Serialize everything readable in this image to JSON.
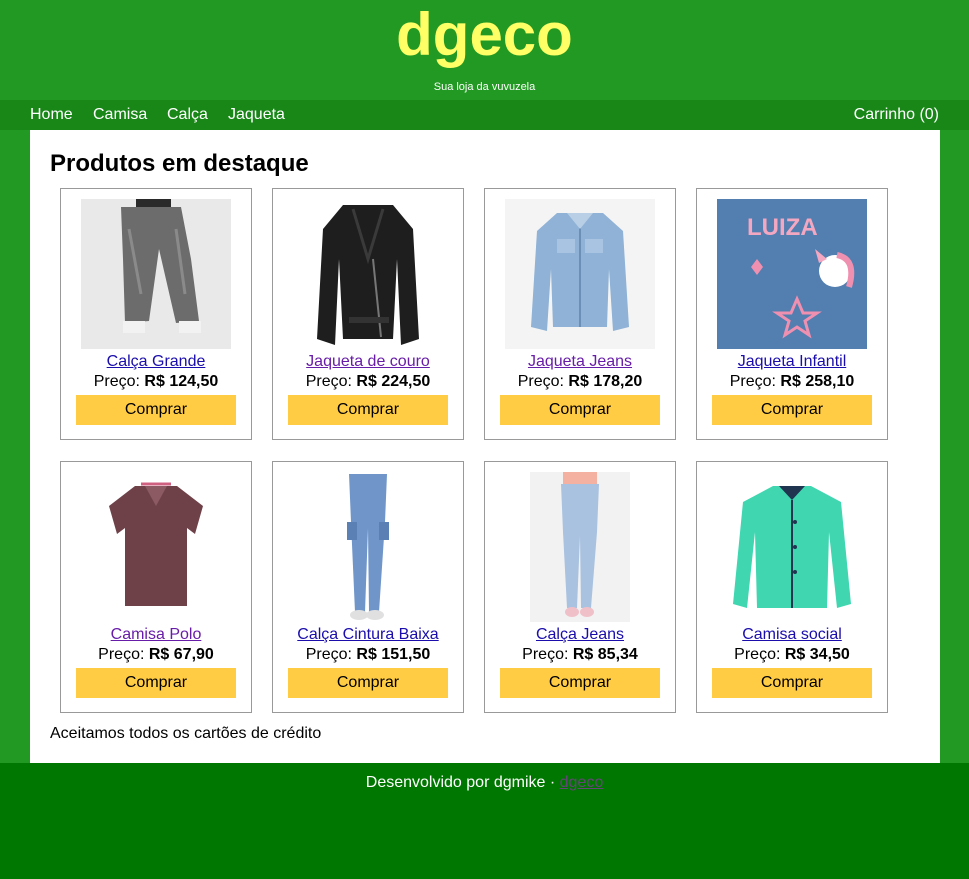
{
  "brand": {
    "name": "dgeco",
    "tagline": "Sua loja da vuvuzela"
  },
  "nav": {
    "items": [
      {
        "label": "Home"
      },
      {
        "label": "Camisa"
      },
      {
        "label": "Calça"
      },
      {
        "label": "Jaqueta"
      }
    ],
    "cart": "Carrinho (0)"
  },
  "main": {
    "title": "Produtos em destaque",
    "price_prefix": "Preço:",
    "buy_label": "Comprar",
    "products": [
      {
        "name": "Calça Grande",
        "price": "R$ 124,50",
        "image": "baggy-jeans-image",
        "link_color": "#1a0dab"
      },
      {
        "name": "Jaqueta de couro",
        "price": "R$ 224,50",
        "image": "leather-jacket-image",
        "link_color": "#681da8"
      },
      {
        "name": "Jaqueta Jeans",
        "price": "R$ 178,20",
        "image": "denim-jacket-image",
        "link_color": "#681da8"
      },
      {
        "name": "Jaqueta Infantil",
        "price": "R$ 258,10",
        "image": "kids-jacket-image",
        "link_color": "#1a0dab"
      },
      {
        "name": "Camisa Polo",
        "price": "R$ 67,90",
        "image": "polo-shirt-image",
        "link_color": "#681da8"
      },
      {
        "name": "Calça Cintura Baixa",
        "price": "R$ 151,50",
        "image": "cargo-jeans-image",
        "link_color": "#1a0dab"
      },
      {
        "name": "Calça Jeans",
        "price": "R$ 85,34",
        "image": "skinny-jeans-image",
        "link_color": "#1a0dab"
      },
      {
        "name": "Camisa social",
        "price": "R$ 34,50",
        "image": "dress-shirt-image",
        "link_color": "#1a0dab"
      }
    ],
    "note": "Aceitamos todos os cartões de crédito"
  },
  "footer": {
    "text": "Desenvolvido por dgmike ·",
    "link": "dgeco"
  },
  "colors": {
    "header": "#229922",
    "nav": "#188718",
    "footer": "#007700",
    "logo": "#ffff66",
    "button": "#ffcc44"
  }
}
